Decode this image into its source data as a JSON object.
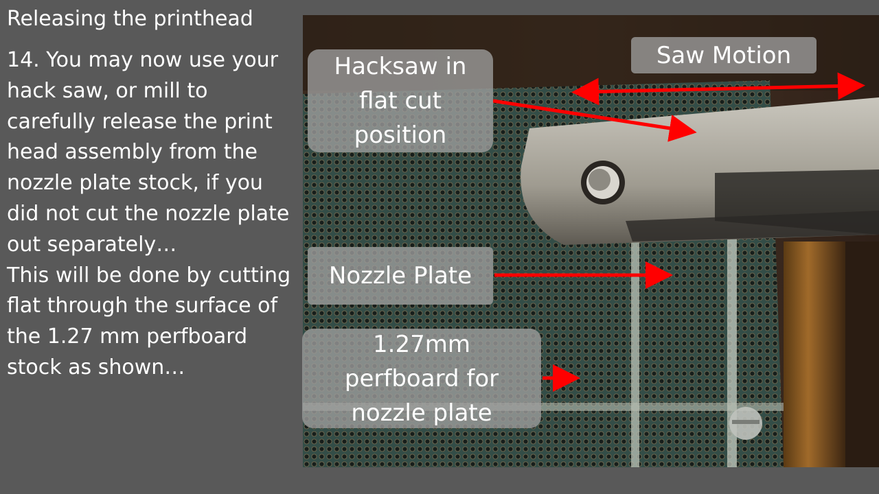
{
  "slide": {
    "title": "Releasing the printhead",
    "body_lines": [
      "14. You may now use your",
      "hack saw, or mill to",
      "carefully release the print",
      "head assembly from the",
      "nozzle plate stock, if you",
      "did not cut the nozzle plate",
      "out separately…",
      "This will be done by cutting",
      "flat through the surface of",
      "the 1.27 mm perfboard",
      "stock as shown…"
    ]
  },
  "callouts": {
    "saw_motion": "Saw Motion",
    "hacksaw": [
      "Hacksaw in",
      "flat cut",
      "position"
    ],
    "nozzle_plate": "Nozzle Plate",
    "perfboard": [
      "1.27mm",
      "perfboard for",
      "nozzle plate"
    ]
  },
  "colors": {
    "background": "#595959",
    "text": "#ffffff",
    "callout": "#9e9e9e",
    "arrow": "#ff0000"
  }
}
